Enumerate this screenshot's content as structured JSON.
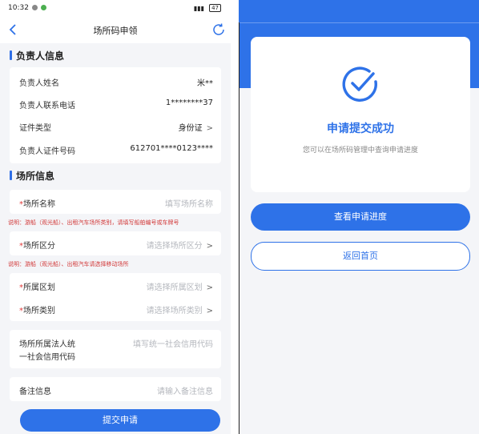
{
  "status_bar": {
    "time": "10:32",
    "battery": "47"
  },
  "left": {
    "nav_title": "场所码申领",
    "section_person": "负责人信息",
    "person_fields": [
      {
        "label": "负责人姓名",
        "value": "米**"
      },
      {
        "label": "负责人联系电话",
        "value": "1********37"
      },
      {
        "label": "证件类型",
        "value": "身份证"
      },
      {
        "label": "负责人证件号码",
        "value": "612701****0123****"
      }
    ],
    "section_place": "场所信息",
    "place_name": {
      "label": "场所名称",
      "placeholder": "填写场所名称"
    },
    "note_name": "说明：游船（观光船）、出租汽车场所类别，请填写船舶编号或车牌号",
    "place_area": {
      "label": "场所区分",
      "placeholder": "请选择场所区分"
    },
    "note_area": "说明：游船（观光船）、出租汽车请选择移动场所",
    "district": {
      "label": "所属区划",
      "placeholder": "请选择所属区划"
    },
    "category": {
      "label": "场所类别",
      "placeholder": "请选择场所类别"
    },
    "credit_code": {
      "label_line1": "场所所属法人统",
      "label_line2": "一社会信用代码",
      "placeholder": "填写统一社会信用代码"
    },
    "remark": {
      "label": "备注信息",
      "placeholder": "请输入备注信息"
    },
    "submit_label": "提交申请"
  },
  "right": {
    "success_title": "申请提交成功",
    "success_sub": "您可以在场所码管理中查询申请进度",
    "view_progress_label": "查看申请进度",
    "back_home_label": "返回首页"
  },
  "colors": {
    "accent": "#2e72e8",
    "required": "#e23a3a",
    "note": "#d23a3a"
  }
}
